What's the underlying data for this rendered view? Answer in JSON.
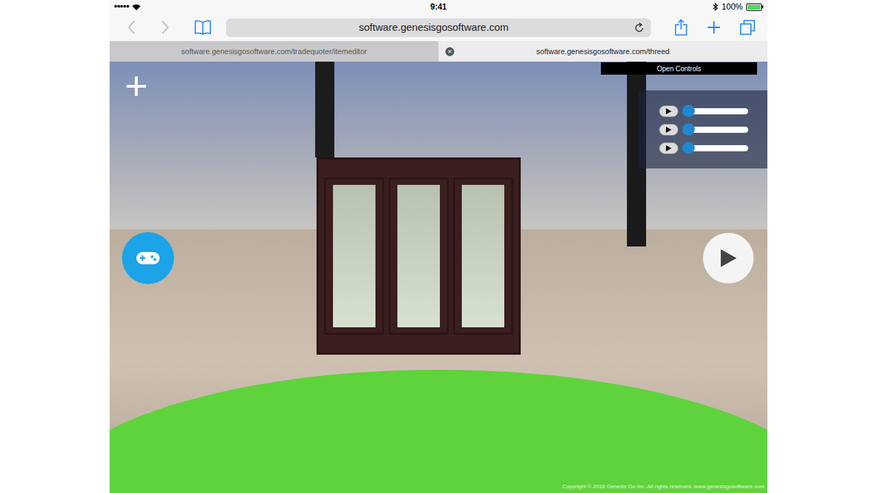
{
  "status_bar": {
    "signal": "●●●●●",
    "time": "9:41",
    "battery": "100%",
    "battery_level": 1
  },
  "address_bar": {
    "url": "software.genesisgosoftware.com"
  },
  "tabs": [
    {
      "label": "software.genesisgosoftware.com/tradequoter/itemeditor",
      "selected": false,
      "close": ""
    },
    {
      "label": "software.genesisgosoftware.com/threed",
      "selected": true,
      "close": "×"
    }
  ],
  "scene": {
    "add": "+",
    "open_controls": "Open Controls",
    "sliders": [
      {
        "level": 0.04
      },
      {
        "level": 0.04
      },
      {
        "level": 0.04
      }
    ],
    "copyright": "Copyright © 2016 Genesis Go Inc. All rights reserved. www.genesisgosoftware.com"
  }
}
